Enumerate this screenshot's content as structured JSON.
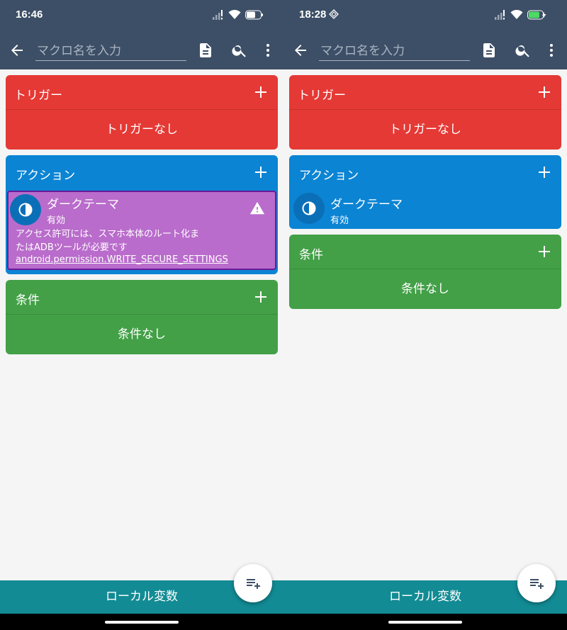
{
  "screens": [
    {
      "status_time": "16:46",
      "macro_name_placeholder": "マクロ名を入力",
      "trigger": {
        "title": "トリガー",
        "empty": "トリガーなし"
      },
      "action": {
        "title": "アクション",
        "item": {
          "title": "ダークテーマ",
          "subtitle": "有効",
          "warning_text": "アクセス許可には、スマホ本体のルート化またはADBツールが必要です",
          "warning_link": "android.permission.WRITE_SECURE_SETTINGS"
        }
      },
      "condition": {
        "title": "条件",
        "empty": "条件なし"
      },
      "bottom_bar": "ローカル変数"
    },
    {
      "status_time": "18:28",
      "macro_name_placeholder": "マクロ名を入力",
      "trigger": {
        "title": "トリガー",
        "empty": "トリガーなし"
      },
      "action": {
        "title": "アクション",
        "item": {
          "title": "ダークテーマ",
          "subtitle": "有効"
        }
      },
      "condition": {
        "title": "条件",
        "empty": "条件なし"
      },
      "bottom_bar": "ローカル変数"
    }
  ],
  "colors": {
    "appbar": "#3d4f66",
    "trigger": "#e53935",
    "action": "#0b84d3",
    "condition": "#43a047",
    "warning_item": "#b96ccb",
    "bottom_bar": "#128b94"
  },
  "icons": [
    "back-arrow-icon",
    "document-icon",
    "search-icon",
    "more-vert-icon",
    "plus-icon",
    "contrast-icon",
    "warning-icon",
    "playlist-add-icon",
    "wifi-icon",
    "signal-icon",
    "battery-icon"
  ]
}
